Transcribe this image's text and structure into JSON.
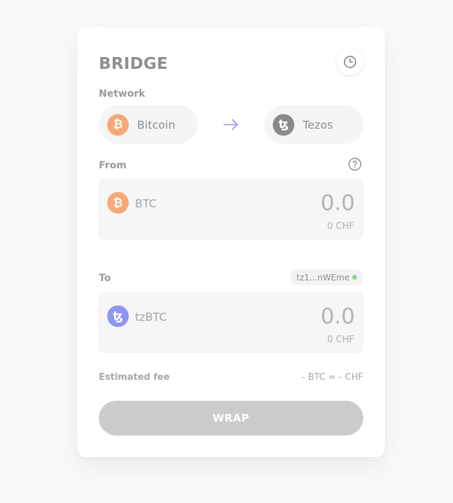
{
  "title": "BRIDGE",
  "network": {
    "label": "Network",
    "source": {
      "name": "Bitcoin",
      "icon": "bitcoin-icon",
      "color": "#f7a876"
    },
    "target": {
      "name": "Tezos",
      "icon": "tezos-icon",
      "color": "#8a8a8a"
    }
  },
  "from": {
    "label": "From",
    "token": "BTC",
    "icon": "bitcoin-icon",
    "amount": "0.0",
    "fiat": "0 CHF"
  },
  "to": {
    "label": "To",
    "address": "tz1...nWEme",
    "token": "tzBTC",
    "icon": "tzbtc-icon",
    "color": "#8c97f3",
    "amount": "0.0",
    "fiat": "0 CHF"
  },
  "fee": {
    "label": "Estimated fee",
    "value": "- BTC ≈ - CHF"
  },
  "action": {
    "label": "WRAP"
  },
  "colors": {
    "accent": "#8c97f3",
    "bitcoin": "#f7a876",
    "status_connected": "#8fd694",
    "button_disabled": "#cbcbcb"
  }
}
